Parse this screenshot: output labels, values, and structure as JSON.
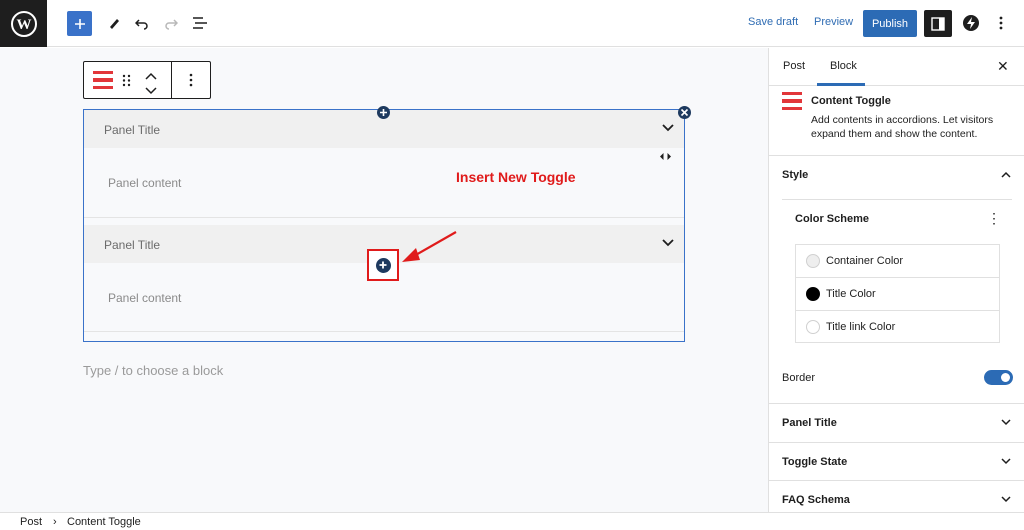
{
  "topbar": {
    "save_draft": "Save draft",
    "preview": "Preview",
    "publish": "Publish",
    "accent": "#2c6bb5"
  },
  "editor": {
    "panels": [
      {
        "title": "Panel Title",
        "content": "Panel content"
      },
      {
        "title": "Panel Title",
        "content": "Panel content"
      }
    ],
    "annotation": "Insert New Toggle",
    "appender": "Type / to choose a block"
  },
  "sidebar": {
    "tabs": [
      "Post",
      "Block"
    ],
    "active_tab": "Block",
    "block": {
      "name": "Content Toggle",
      "description": "Add contents in accordions. Let visitors expand them and show the content."
    },
    "style_label": "Style",
    "color_scheme_label": "Color Scheme",
    "colors": [
      {
        "label": "Container Color",
        "swatch": "#eeeeee"
      },
      {
        "label": "Title Color",
        "swatch": "#000000"
      },
      {
        "label": "Title link Color",
        "swatch": "#ffffff"
      }
    ],
    "border_label": "Border",
    "border_enabled": true,
    "sections": [
      "Panel Title",
      "Toggle State",
      "FAQ Schema"
    ]
  },
  "breadcrumb": [
    "Post",
    "Content Toggle"
  ]
}
